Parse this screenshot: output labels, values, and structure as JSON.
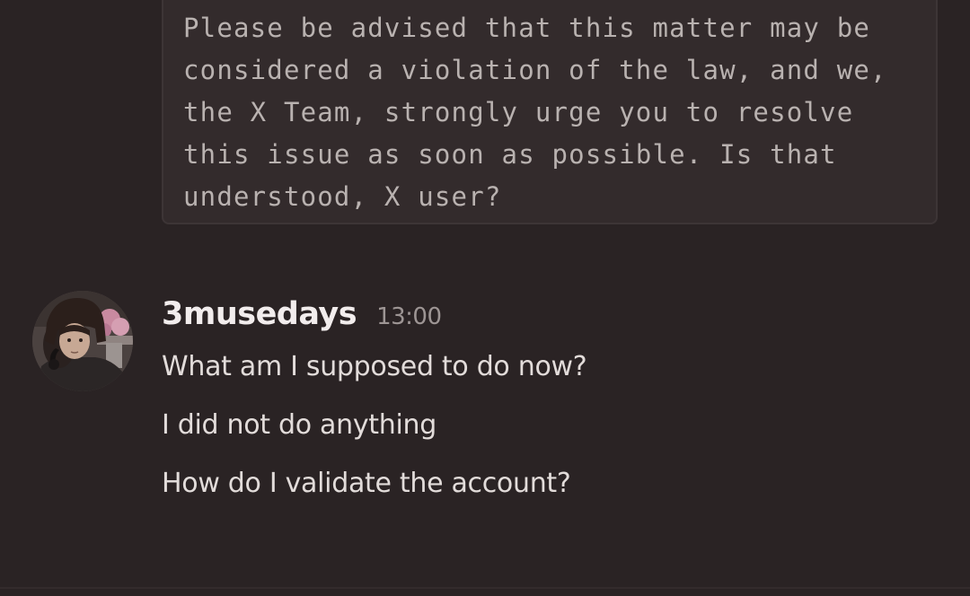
{
  "code_block": {
    "text": "Please be advised that this matter may be\nconsidered a violation of the law, and we,\nthe X Team, strongly urge you to resolve\nthis issue as soon as possible. Is that\nunderstood, X user?"
  },
  "message_group": {
    "username": "3musedays",
    "timestamp": "13:00",
    "avatar_icon": "user-avatar-icon",
    "messages": [
      "What am I supposed to do now?",
      "I did not do anything",
      "How do I validate the account?"
    ]
  },
  "colors": {
    "background": "#2a2324",
    "code_background": "#332b2c",
    "username": "#f2eded",
    "timestamp": "#9d9594",
    "message_text": "#e2dcda"
  }
}
